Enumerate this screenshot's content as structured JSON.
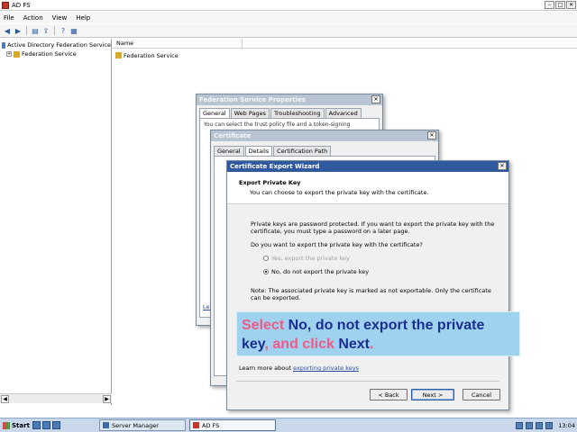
{
  "window": {
    "title": "AD FS"
  },
  "menu": [
    "File",
    "Action",
    "View",
    "Help"
  ],
  "tree": {
    "root_label": "Active Directory Federation Service",
    "child_label": "Federation Service"
  },
  "list": {
    "column_name": "Name",
    "rows": [
      "Federation Service"
    ]
  },
  "props_dialog": {
    "title": "Federation Service Properties",
    "tabs": [
      "General",
      "Web Pages",
      "Troubleshooting",
      "Advanced"
    ],
    "body_text": "You can select the trust policy file and a token-signing",
    "link_text": "Lea"
  },
  "cert_dialog": {
    "title": "Certificate",
    "tabs": [
      "General",
      "Details",
      "Certification Path"
    ]
  },
  "wizard": {
    "title": "Certificate Export Wizard",
    "heading": "Export Private Key",
    "subheading": "You can choose to export the private key with the certificate.",
    "para1": "Private keys are password protected. If you want to export the private key with the certificate, you must type a password on a later page.",
    "question": "Do you want to export the private key with the certificate?",
    "option_yes": "Yes, export the private key",
    "option_no": "No, do not export the private key",
    "note": "Note: The associated private key is marked as not exportable. Only the certificate can be exported.",
    "learn_prefix": "Learn more about ",
    "learn_link": "exporting private keys",
    "back": "< Back",
    "next": "Next >",
    "cancel": "Cancel"
  },
  "callout": {
    "w1": "Select ",
    "w2": "No, do not export the private key",
    "w3": ", and click ",
    "w4": "Next",
    "w5": "."
  },
  "taskbar": {
    "start": "Start",
    "tasks": [
      "Server Manager",
      "AD FS"
    ],
    "clock": "13:04"
  },
  "colors": {
    "callout_bg": "#9fd2ef",
    "callout_pink": "#f05a87",
    "callout_blue": "#1b2f8f",
    "active_title": "#2f5aa0"
  }
}
